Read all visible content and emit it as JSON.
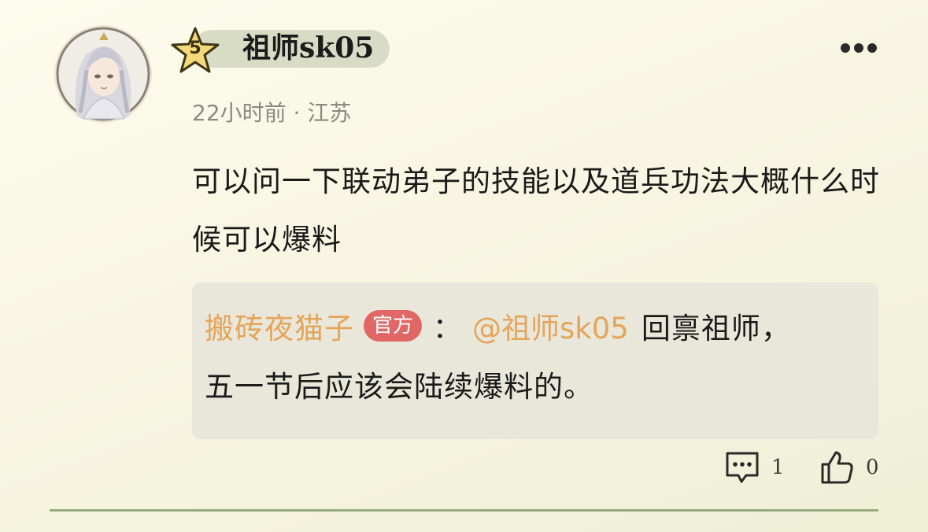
{
  "user": {
    "name": "祖师sk05",
    "level": "5",
    "avatar_icon": "avatar-portrait"
  },
  "post": {
    "time": "22小时前",
    "location": "江苏",
    "separator": "·",
    "text": "可以问一下联动弟子的技能以及道兵功法大概什么时候可以爆料"
  },
  "reply": {
    "author": "搬砖夜猫子",
    "badge": "官方",
    "colon": "：",
    "mention": "@祖师sk05",
    "text_line1": "回禀祖师，",
    "text_line2": "五一节后应该会陆续爆料的。"
  },
  "actions": {
    "comment_count": "1",
    "like_count": "0",
    "more_icon": "more-dots-icon"
  },
  "colors": {
    "accent": "#e4a55a",
    "badge": "#e06765",
    "divider": "#97aa80"
  }
}
